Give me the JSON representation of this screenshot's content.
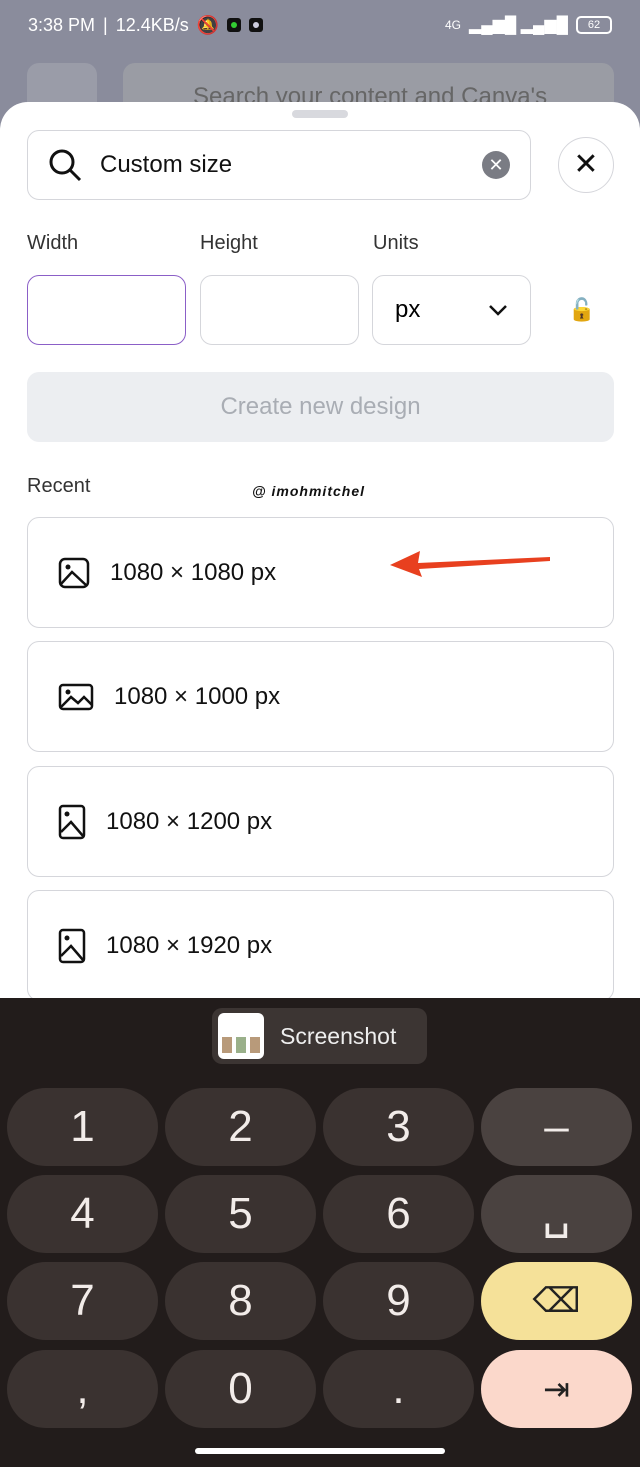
{
  "status": {
    "time": "3:38 PM",
    "speed": "12.4KB/s",
    "network": "4G",
    "battery": "62"
  },
  "background": {
    "search_placeholder": "Search your content and Canva's"
  },
  "sheet": {
    "search_value": "Custom size",
    "width_label": "Width",
    "height_label": "Height",
    "units_label": "Units",
    "width_value": "",
    "height_value": "",
    "units_value": "px",
    "create_label": "Create new design",
    "recent_label": "Recent",
    "watermark": "@ imohmitchel",
    "recent": [
      {
        "label": "1080 × 1080 px",
        "icon": "image-square-icon"
      },
      {
        "label": "1080 × 1000 px",
        "icon": "image-landscape-icon"
      },
      {
        "label": "1080 × 1200 px",
        "icon": "image-portrait-icon"
      },
      {
        "label": "1080 × 1920 px",
        "icon": "image-portrait-icon"
      }
    ],
    "annotation_color": "#e8401f"
  },
  "keyboard": {
    "suggestion": "Screenshot",
    "keys": [
      "1",
      "2",
      "3",
      "–",
      "4",
      "5",
      "6",
      "␣",
      "7",
      "8",
      "9",
      "⌫",
      ",",
      "0",
      ".",
      "⇥"
    ]
  }
}
